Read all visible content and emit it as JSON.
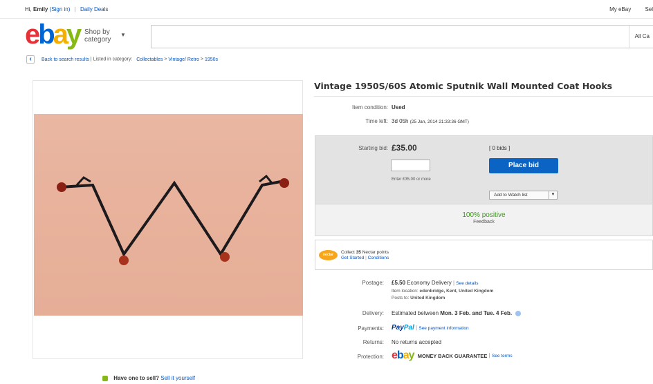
{
  "topbar": {
    "greeting_prefix": "Hi,",
    "user_name": "Emily",
    "sign_in": "(Sign in)",
    "daily_deals": "Daily Deals",
    "my_ebay": "My eBay",
    "sell_partial": "Sel"
  },
  "header": {
    "logo": {
      "e": "e",
      "b": "b",
      "a": "a",
      "y": "y"
    },
    "shop_by_line1": "Shop by",
    "shop_by_line2": "category",
    "search_value": "",
    "search_category": "All Ca"
  },
  "breadcrumb": {
    "back": "Back to search results",
    "listed_in": "Listed in category:",
    "items": [
      "Collectables",
      "Vintage/ Retro",
      "1950s"
    ],
    "separator": ">"
  },
  "item": {
    "title": "Vintage 1950S/60S Atomic Sputnik Wall Mounted Coat Hooks",
    "condition_label": "Item condition:",
    "condition_value": "Used",
    "time_left_label": "Time left:",
    "time_left_value": "3d 05h",
    "time_left_detail": "(25 Jan, 2014  21:33:36 GMT)"
  },
  "bid": {
    "starting_bid_label": "Starting bid:",
    "starting_bid_value": "£35.00",
    "bids_link": "[ 0 bids ]",
    "input_value": "",
    "hint": "Enter £35.00 or more",
    "place_bid": "Place bid",
    "watch_list": "Add to Watch list",
    "seller_feedback": "100% positive",
    "feedback_label": "Feedback"
  },
  "nectar": {
    "badge": "nectar",
    "collect_prefix": "Collect",
    "collect_points": "35",
    "collect_suffix": "Nectar points",
    "get_started": "Get Started",
    "conditions": "Conditions"
  },
  "shipping": {
    "postage_label": "Postage:",
    "postage_price": "£5.50",
    "postage_service": "Economy Delivery",
    "see_details": "See details",
    "item_location_label": "Item location:",
    "item_location_value": "edenbridge, Kent, United Kingdom",
    "posts_to_label": "Posts to:",
    "posts_to_value": "United Kingdom",
    "delivery_label": "Delivery:",
    "delivery_prefix": "Estimated between",
    "delivery_dates": "Mon. 3 Feb. and Tue. 4 Feb.",
    "payments_label": "Payments:",
    "paypal_p1": "Pay",
    "paypal_p2": "Pal",
    "see_payment": "See payment information",
    "returns_label": "Returns:",
    "returns_value": "No returns accepted",
    "protection_label": "Protection:",
    "mbg": "MONEY BACK GUARANTEE",
    "see_terms": "See terms"
  },
  "sell": {
    "question": "Have one to sell?",
    "link": "Sell it yourself"
  },
  "colors": {
    "place_bid": "#0b63c4",
    "feedback_green": "#3a9a17",
    "link": "#0654ba"
  }
}
